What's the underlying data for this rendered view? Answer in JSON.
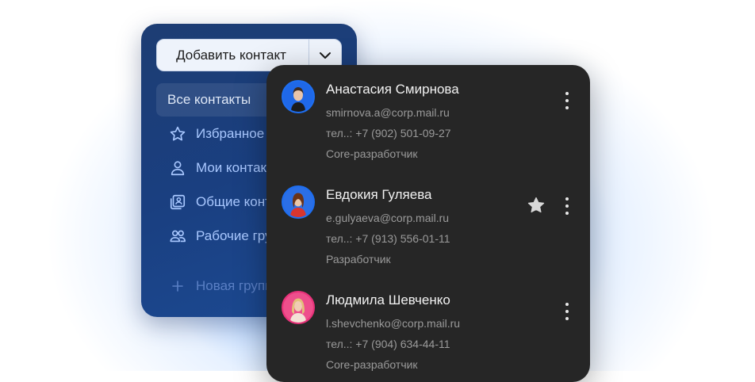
{
  "colors": {
    "accent": "#1e6ef0",
    "panel_dark": "#262626",
    "panel_left": "#1a3f80",
    "nav_text": "#a9c8ff"
  },
  "left_panel": {
    "add_button": {
      "label": "Добавить контакт",
      "caret_icon": "chevron-down-icon"
    },
    "nav": [
      {
        "label": "Все контакты",
        "icon": null,
        "active": true
      },
      {
        "label": "Избранное",
        "icon": "star-outline-icon"
      },
      {
        "label": "Мои контакты",
        "icon": "person-icon"
      },
      {
        "label": "Общие контакты",
        "icon": "contact-card-icon"
      },
      {
        "label": "Рабочие группы",
        "icon": "people-icon"
      }
    ],
    "new_group": {
      "label": "Новая группа",
      "icon": "plus-icon"
    }
  },
  "contacts": [
    {
      "name": "Анастасия Смирнова",
      "email": "smirnova.a@corp.mail.ru",
      "phone": "тел..: +7 (902) 501-09-27",
      "role": "Core-разработчик",
      "favorite": false,
      "avatar_ring": "#1e6ef0"
    },
    {
      "name": "Евдокия Гуляева",
      "email": "e.gulyaeva@corp.mail.ru",
      "phone": "тел..: +7 (913) 556-01-11",
      "role": "Разработчик",
      "favorite": true,
      "avatar_ring": "#1e6ef0"
    },
    {
      "name": "Людмила Шевченко",
      "email": "l.shevchenko@corp.mail.ru",
      "phone": "тел..: +7 (904) 634-44-11",
      "role": "Core-разработчик",
      "favorite": false,
      "avatar_ring": "#e8327a"
    }
  ]
}
